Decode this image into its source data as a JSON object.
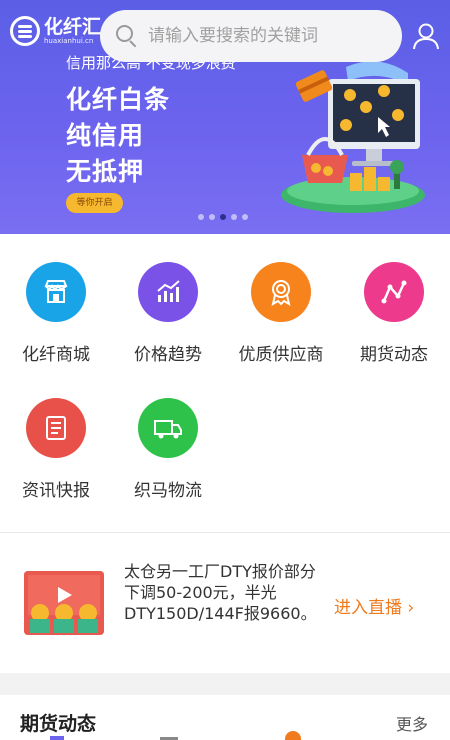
{
  "header": {
    "logo_cn": "化纤汇",
    "logo_en": "huaxianhui.cn",
    "search_placeholder": "请输入要搜索的关键词"
  },
  "banner": {
    "top_text": "信用那么高 不变现多浪费",
    "lines": [
      "化纤白条",
      "纯信用",
      "无抵押"
    ],
    "button": "等你开启",
    "dot_count": 5,
    "active_dot": 2,
    "colors": {
      "bg": "#6c63ee",
      "button": "#f5b82e"
    }
  },
  "grid": {
    "items": [
      {
        "label": "化纤商城",
        "icon": "shop-icon",
        "color": "#1aa4e8"
      },
      {
        "label": "价格趋势",
        "icon": "trend-chart-icon",
        "color": "#7b52e8"
      },
      {
        "label": "优质供应商",
        "icon": "medal-icon",
        "color": "#f7831d"
      },
      {
        "label": "期货动态",
        "icon": "line-graph-icon",
        "color": "#ee3a8c"
      },
      {
        "label": "资讯快报",
        "icon": "news-icon",
        "color": "#e8504a"
      },
      {
        "label": "织马物流",
        "icon": "truck-icon",
        "color": "#2ec24a"
      }
    ]
  },
  "live": {
    "text": "太仓另一工厂DTY报价部分下调50-200元，半光DTY150D/144F报9660。",
    "link": "进入直播 ›"
  },
  "section": {
    "title": "期货动态",
    "more": "更多"
  }
}
